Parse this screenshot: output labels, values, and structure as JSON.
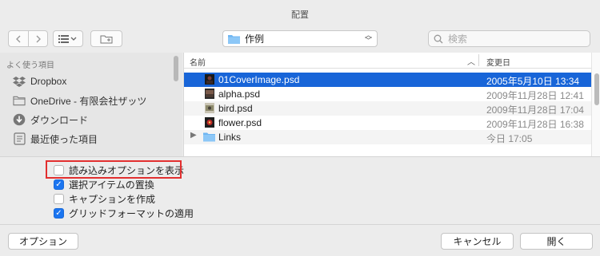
{
  "window": {
    "title": "配置"
  },
  "toolbar": {
    "location": "作例",
    "search_placeholder": "検索"
  },
  "sidebar": {
    "section_title": "よく使う項目",
    "items": [
      {
        "label": "Dropbox",
        "icon": "dropbox-icon"
      },
      {
        "label": "OneDrive - 有限会社ザッツ",
        "icon": "folder-icon"
      },
      {
        "label": "ダウンロード",
        "icon": "download-icon"
      },
      {
        "label": "最近使った項目",
        "icon": "recents-icon"
      }
    ]
  },
  "file_list": {
    "columns": {
      "name": "名前",
      "date": "変更日"
    },
    "rows": [
      {
        "name": "01CoverImage.psd",
        "date": "2005年5月10日 13:34",
        "selected": true,
        "type": "psd"
      },
      {
        "name": "alpha.psd",
        "date": "2009年11月28日 12:41",
        "selected": false,
        "type": "psd"
      },
      {
        "name": "bird.psd",
        "date": "2009年11月28日 17:04",
        "selected": false,
        "type": "psd"
      },
      {
        "name": "flower.psd",
        "date": "2009年11月28日 16:38",
        "selected": false,
        "type": "psd"
      },
      {
        "name": "Links",
        "date": "今日 17:05",
        "selected": false,
        "type": "folder"
      }
    ]
  },
  "options": [
    {
      "label": "読み込みオプションを表示",
      "checked": false
    },
    {
      "label": "選択アイテムの置換",
      "checked": true
    },
    {
      "label": "キャプションを作成",
      "checked": false
    },
    {
      "label": "グリッドフォーマットの適用",
      "checked": true
    }
  ],
  "footer": {
    "options_button": "オプション",
    "cancel_button": "キャンセル",
    "open_button": "開く"
  },
  "colors": {
    "selection": "#1865d8",
    "checkbox_on": "#1b75f0",
    "highlight_box": "#e22f2f"
  }
}
